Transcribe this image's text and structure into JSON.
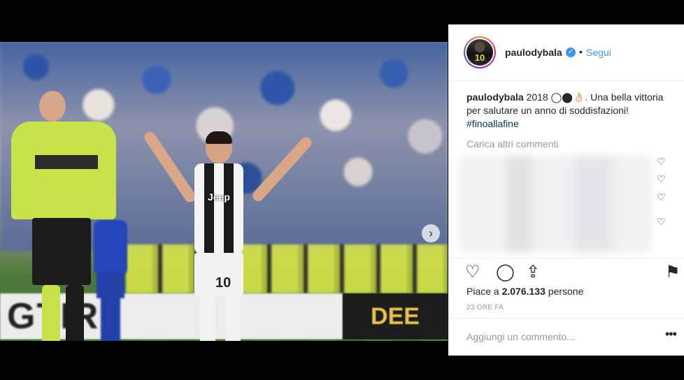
{
  "post": {
    "username": "paulodybala",
    "follow_label": "Segui",
    "separator": "•",
    "verified_glyph": "✓",
    "avatar_number": "10",
    "caption": {
      "user": "paulodybala",
      "text": " 2018 ◯⬤👌🏻. Una bella vittoria per salutare un anno di soddisfazioni! ",
      "hashtag": "#finoallafine"
    },
    "load_more_label": "Carica altri commenti",
    "likes_prefix": "Piace a ",
    "likes_count": "2.076.133",
    "likes_suffix": " persone",
    "time_ago": "23 ORE FA",
    "comment_placeholder": "Aggiungi un commento...",
    "more_options": "•••"
  },
  "photo": {
    "sponsor": "Jeep",
    "shirt_number": "10",
    "board_left": "GTIR",
    "board_right": "DEE",
    "next_arrow": "›"
  },
  "icons": {
    "heart": "♡",
    "comment": "◯",
    "share": "⇪",
    "bookmark": "⚑"
  }
}
